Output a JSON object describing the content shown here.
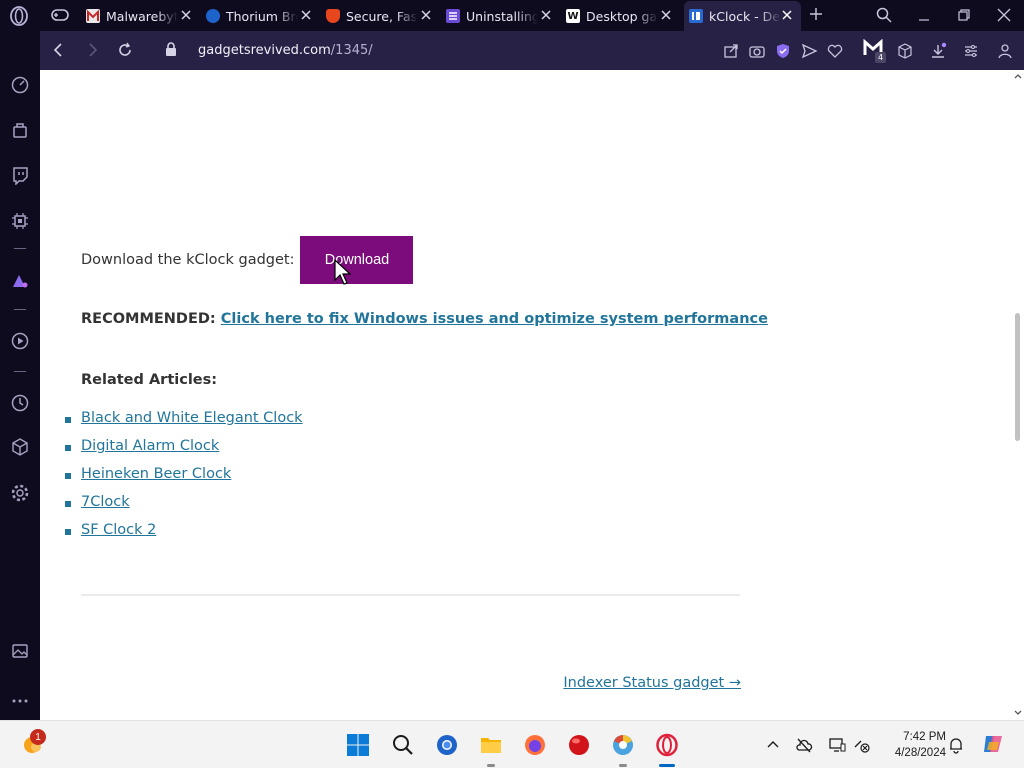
{
  "browser": {
    "tabs": [
      {
        "title": "Malwarebytes",
        "favicon_color": "#c62828"
      },
      {
        "title": "Thorium Browser",
        "favicon_color": "#1e63c9"
      },
      {
        "title": "Secure, Fast,",
        "favicon_color": "#e8471d"
      },
      {
        "title": "Uninstalling",
        "favicon_color": "#6b4ad6"
      },
      {
        "title": "Desktop gadgets",
        "favicon_color": "#ffffff",
        "favicon_letter": "W"
      },
      {
        "title": "kClock - Desktop",
        "favicon_color": "#2a6bd1",
        "active": true
      }
    ],
    "address": {
      "domain": "gadgetsrevived.com",
      "path": "/1345/"
    },
    "extension_badge": "4"
  },
  "page": {
    "download_label": "Download the kClock gadget:",
    "download_button": "Download",
    "recommended_label": "RECOMMENDED:",
    "recommended_link": "Click here to fix Windows issues and optimize system performance",
    "related_heading": "Related Articles:",
    "related_articles": [
      "Black and White Elegant Clock",
      "Digital Alarm Clock",
      "Heineken Beer Clock",
      "7Clock",
      "SF Clock 2"
    ],
    "next_link": "Indexer Status gadget →",
    "colors": {
      "button": "#7c0b7c",
      "link": "#21759b"
    }
  },
  "taskbar": {
    "notification_count": "1",
    "time": "7:42 PM",
    "date": "4/28/2024"
  }
}
